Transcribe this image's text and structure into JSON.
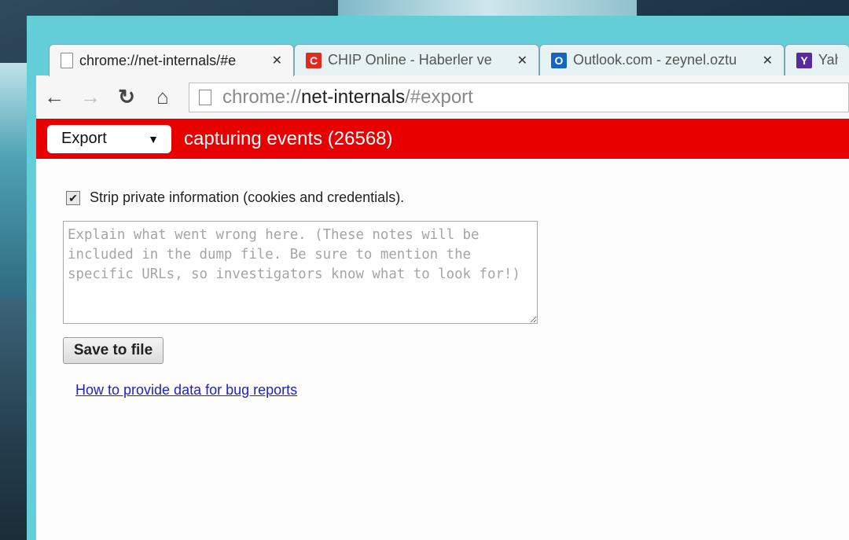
{
  "tabs": [
    {
      "title": "chrome://net-internals/#e",
      "icon": "page-icon",
      "active": true
    },
    {
      "title": "CHIP Online - Haberler ve",
      "icon": "chip-icon",
      "active": false
    },
    {
      "title": "Outlook.com - zeynel.oztu",
      "icon": "outlook-icon",
      "active": false
    },
    {
      "title": "Yaho",
      "icon": "yahoo-icon",
      "active": false
    }
  ],
  "tab_close_glyph": "✕",
  "url": {
    "scheme": "chrome://",
    "host": "net-internals",
    "path": "/#export"
  },
  "view_select": {
    "value": "Export"
  },
  "status_text": "capturing events (26568)",
  "strip_private": {
    "label": "Strip private information (cookies and credentials).",
    "checked": true
  },
  "notes": {
    "placeholder": "Explain what went wrong here. (These notes will be included in the dump file. Be sure to mention the specific URLs, so investigators know what to look for!)",
    "value": ""
  },
  "save_button": "Save to file",
  "help_link": "How to provide data for bug reports",
  "colors": {
    "status_bar": "#e80000",
    "window_frame": "#63cdd8",
    "link": "#2020c8"
  }
}
